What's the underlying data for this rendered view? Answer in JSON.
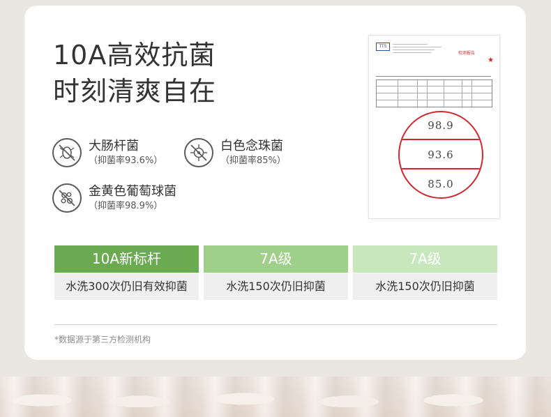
{
  "title": {
    "line1": "10A高效抗菌",
    "line2": "时刻清爽自在"
  },
  "features": [
    {
      "icon": "bacteria-crossed-icon",
      "name": "大肠杆菌",
      "rate": "（抑菌率93.6%）"
    },
    {
      "icon": "virus-crossed-icon",
      "name": "白色念珠菌",
      "rate": "（抑菌率85%）"
    },
    {
      "icon": "cocci-crossed-icon",
      "name": "金黄色葡萄球菌",
      "rate": "（抑菌率98.9%）"
    }
  ],
  "report": {
    "logo": "TTS",
    "heading": "检测报告",
    "zoom_values": [
      "98.9",
      "93.6",
      "85.0"
    ]
  },
  "comparison": [
    {
      "head": "10A新标杆",
      "body": "水洗300次仍旧有效抑菌"
    },
    {
      "head": "7A级",
      "body": "水洗150次仍旧抑菌"
    },
    {
      "head": "7A级",
      "body": "水洗150次仍旧抑菌"
    }
  ],
  "note": "*数据源于第三方检测机构",
  "colors": {
    "green_dark": "#6aab52",
    "green_mid": "#9fd08a",
    "green_light": "#c9e7bd",
    "red_circle": "#d0282e"
  }
}
